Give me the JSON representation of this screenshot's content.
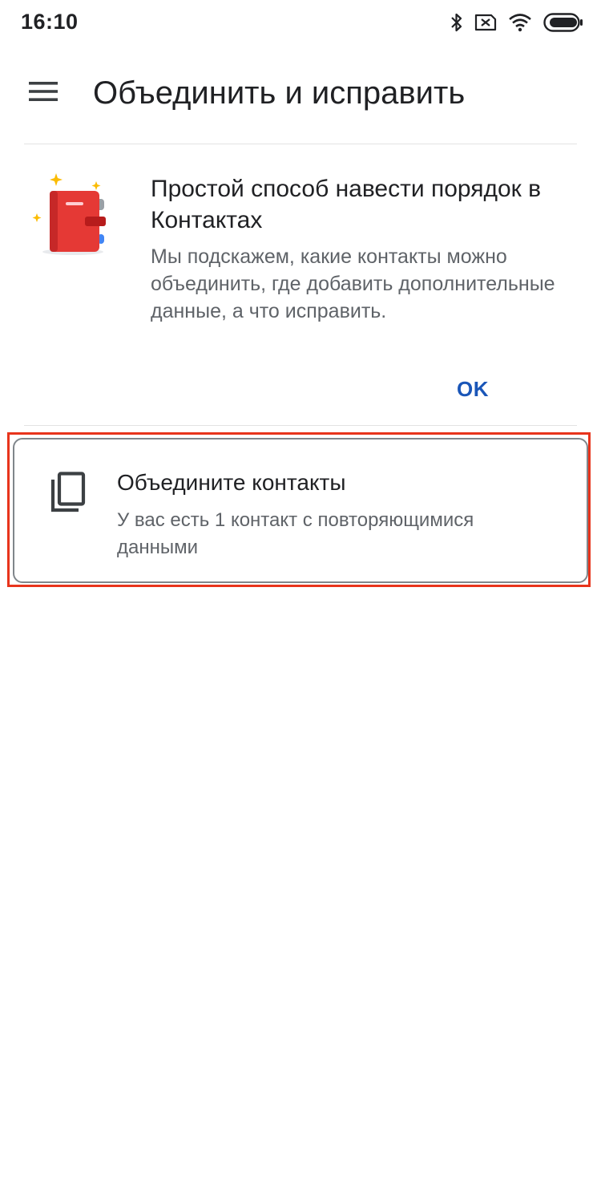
{
  "status_bar": {
    "time": "16:10",
    "icons": [
      "bluetooth-icon",
      "no-sim-icon",
      "wifi-icon",
      "battery-icon"
    ]
  },
  "app_bar": {
    "menu_icon": "hamburger-menu-icon",
    "title": "Объединить и исправить"
  },
  "promo": {
    "illustration": "red-address-book-icon",
    "title": "Простой способ навести порядок в Контактах",
    "body": "Мы подскажем, какие контакты можно объединить, где добавить дополнительные данные, а что исправить.",
    "ok_label": "OK"
  },
  "merge_card": {
    "icon": "copy-icon",
    "title": "Объедините контакты",
    "subtitle": "У вас есть 1 контакт с повторяющимися данными"
  },
  "colors": {
    "accent_blue": "#1a56b8",
    "highlight_red": "#e8341c",
    "book_red": "#e53935",
    "text_primary": "#202124",
    "text_secondary": "#5f6368"
  }
}
